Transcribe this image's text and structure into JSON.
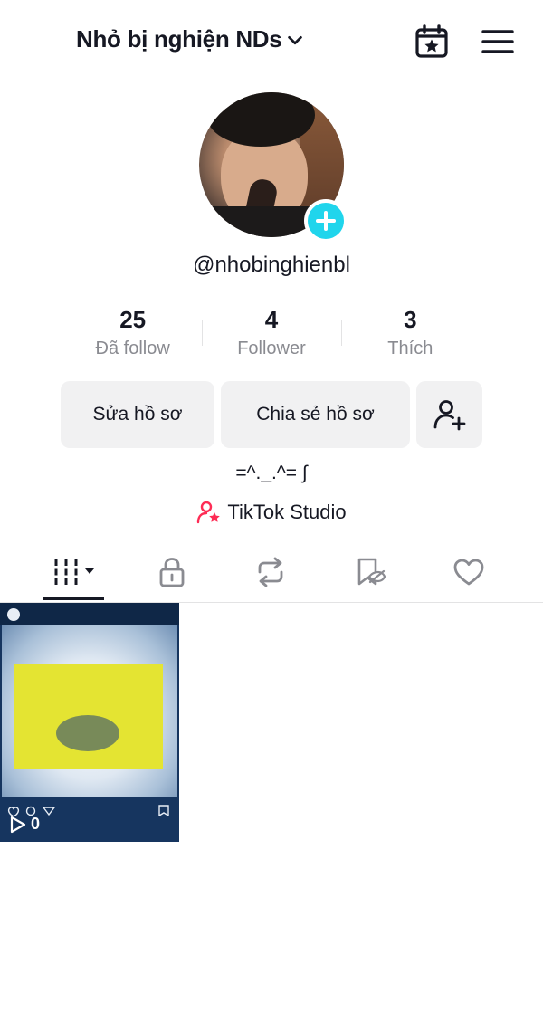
{
  "header": {
    "display_name": "Nhỏ bị nghiện NDs",
    "chevron_icon": "chevron-down-icon",
    "calendar_icon": "calendar-star-icon",
    "menu_icon": "hamburger-menu-icon"
  },
  "profile": {
    "username": "@nhobinghienbl",
    "add_avatar_icon": "plus-icon",
    "accent_color": "#20d5ec"
  },
  "stats": [
    {
      "value": "25",
      "label": "Đã follow"
    },
    {
      "value": "4",
      "label": "Follower"
    },
    {
      "value": "3",
      "label": "Thích"
    }
  ],
  "actions": {
    "edit_label": "Sửa hồ sơ",
    "share_label": "Chia sẻ hồ sơ",
    "add_friend_icon": "add-user-icon"
  },
  "bio": "=^._.^= ∫",
  "studio": {
    "label": "TikTok Studio",
    "icon": "creator-star-icon",
    "icon_color": "#fe2c55"
  },
  "tabs": [
    {
      "name": "videos",
      "icon": "grid-dropdown-icon",
      "active": true
    },
    {
      "name": "private",
      "icon": "lock-icon",
      "active": false
    },
    {
      "name": "reposts",
      "icon": "repost-icon",
      "active": false
    },
    {
      "name": "favorites",
      "icon": "bookmark-hidden-icon",
      "active": false
    },
    {
      "name": "liked",
      "icon": "heart-icon",
      "active": false
    }
  ],
  "videos": [
    {
      "view_count": "0",
      "play_icon": "play-icon"
    }
  ]
}
